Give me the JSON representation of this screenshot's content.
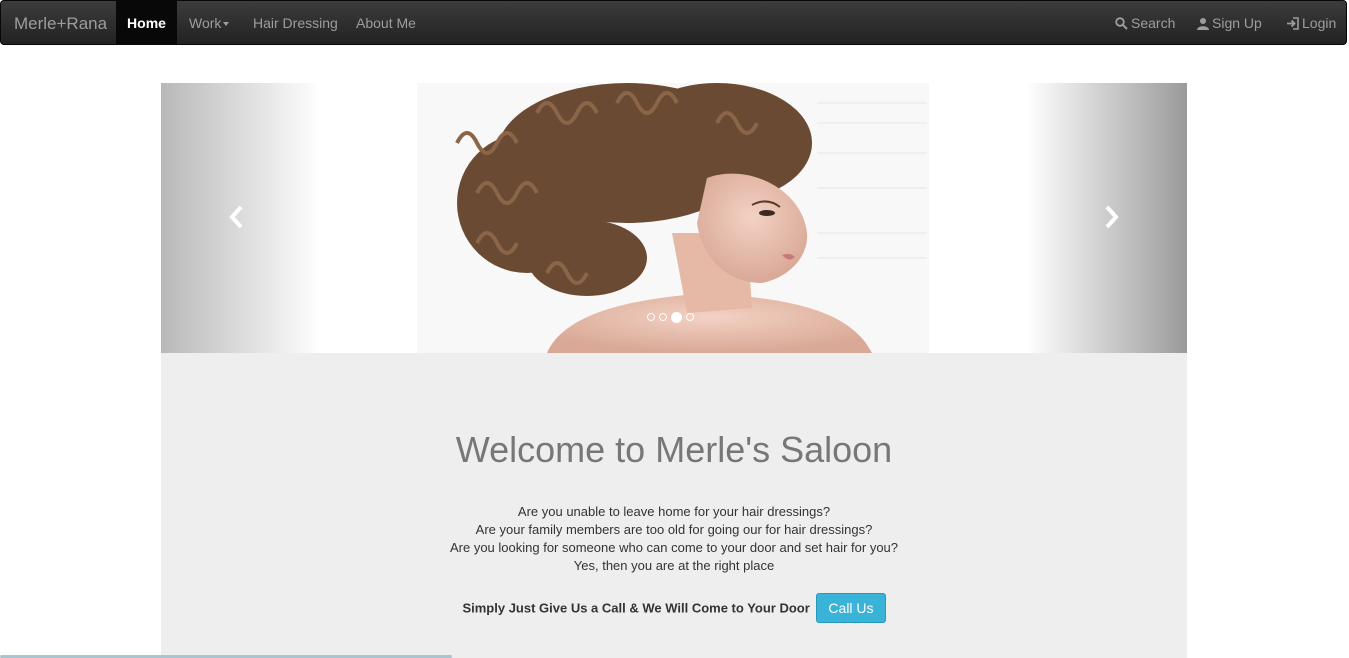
{
  "navbar": {
    "brand": "Merle+Rana",
    "items": [
      {
        "label": "Home",
        "active": true
      },
      {
        "label": "Work",
        "dropdown": true
      },
      {
        "label": "Hair Dressing"
      },
      {
        "label": "About Me"
      }
    ],
    "right": [
      {
        "label": "Search",
        "icon": "search-icon"
      },
      {
        "label": "Sign Up",
        "icon": "user-icon"
      },
      {
        "label": "Login",
        "icon": "login-icon"
      }
    ]
  },
  "carousel": {
    "indicator_count": 4,
    "active_indicator": 3,
    "prev_icon": "chevron-left-icon",
    "next_icon": "chevron-right-icon"
  },
  "hero": {
    "title": "Welcome to Merle's Saloon",
    "lines": [
      "Are you unable to leave home for your hair dressings?",
      "Are your family members are too old for going our for hair dressings?",
      "Are you looking for someone who can come to your door and set hair for you?",
      "Yes, then you are at the right place"
    ],
    "cta_text": "Simply Just Give Us a Call & We Will Come to Your Door",
    "cta_button": "Call Us"
  },
  "colors": {
    "navbar": "#222222",
    "accent_button": "#39b3d7",
    "jumbotron": "#eeeeee"
  }
}
